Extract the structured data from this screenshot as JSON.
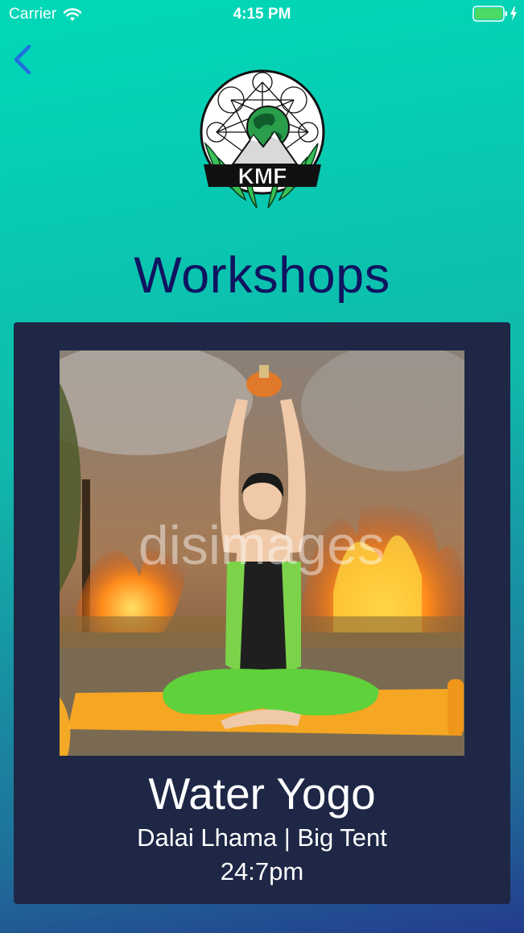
{
  "status_bar": {
    "carrier": "Carrier",
    "time": "4:15 PM"
  },
  "nav": {
    "back_icon": "chevron-left-icon"
  },
  "logo": {
    "text": "KMF"
  },
  "page": {
    "title": "Workshops"
  },
  "workshop": {
    "title": "Water Yogo",
    "host_location": "Dalai Lhama | Big Tent",
    "time": "24:7pm",
    "image_watermark": "disimages"
  },
  "colors": {
    "title": "#0f1460",
    "card": "#1e2745",
    "back_accent": "#1f6fe0",
    "battery": "#4cd964"
  }
}
